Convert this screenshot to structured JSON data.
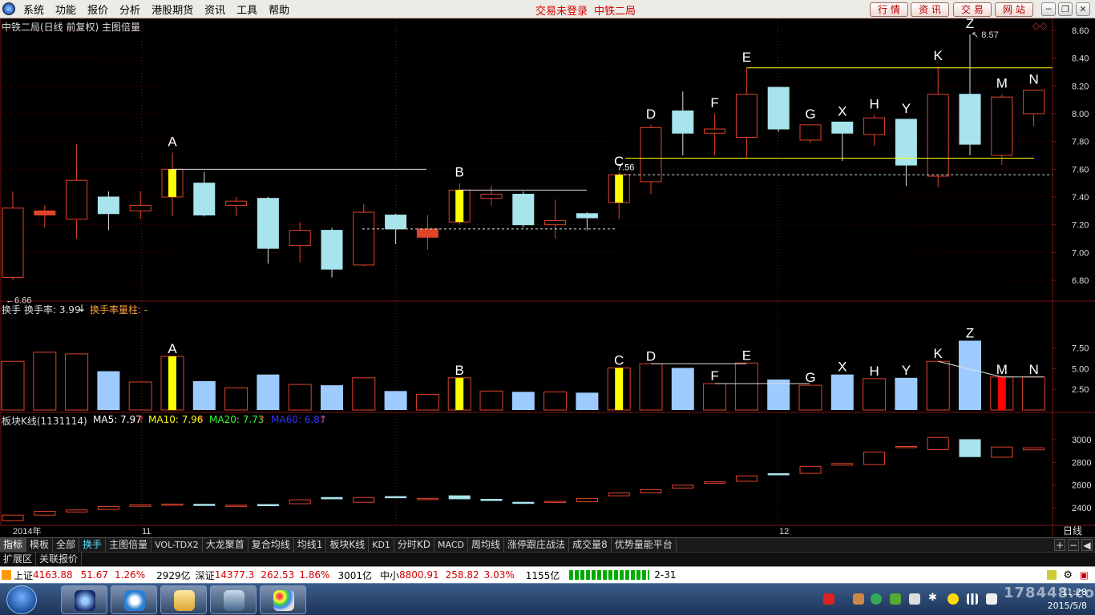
{
  "menubar": {
    "items": [
      "系统",
      "功能",
      "报价",
      "分析",
      "港股期货",
      "资讯",
      "工具",
      "帮助"
    ],
    "trade_status": "交易未登录",
    "stock_name": "中铁二局",
    "buttons": [
      "行 情",
      "资 讯",
      "交 易",
      "网 站"
    ]
  },
  "main_panel": {
    "title": "中铁二局(日线 前复权) 主图倍量",
    "y_ticks": [
      "8.60",
      "8.40",
      "8.20",
      "8.00",
      "7.80",
      "7.60",
      "7.40",
      "7.20",
      "7.00",
      "6.80"
    ],
    "low_label": "6.66",
    "high_label": "8.57",
    "c_label": "7.56"
  },
  "turnover_panel": {
    "label1": "换手",
    "label2": "换手率: 3.99",
    "label3": "换手率量柱: -",
    "y_ticks": [
      "7.50",
      "5.00",
      "2.50"
    ]
  },
  "sector_panel": {
    "label": "板块K线(1131114)",
    "ma5": "MA5: 7.97",
    "ma10": "MA10: 7.96",
    "ma20": "MA20: 7.73",
    "ma60": "MA60: 6.87",
    "y_ticks": [
      "3000",
      "2800",
      "2600",
      "2400"
    ]
  },
  "x_axis": {
    "labels": [
      "2014年",
      "11",
      "12"
    ],
    "period": "日线"
  },
  "chart_data": {
    "type": "candlestick",
    "candles": [
      [
        7.32,
        6.82,
        7.44,
        6.8,
        "up"
      ],
      [
        7.27,
        7.3,
        7.34,
        7.18,
        "dn"
      ],
      [
        7.52,
        7.24,
        7.78,
        7.1,
        "up"
      ],
      [
        7.4,
        7.28,
        7.44,
        7.16,
        "cy"
      ],
      [
        7.34,
        7.3,
        7.44,
        7.24,
        "up"
      ],
      [
        7.6,
        7.4,
        7.72,
        7.26,
        "yl"
      ],
      [
        7.5,
        7.27,
        7.58,
        7.26,
        "cy"
      ],
      [
        7.37,
        7.34,
        7.4,
        7.26,
        "up"
      ],
      [
        7.39,
        7.03,
        7.4,
        6.92,
        "cy"
      ],
      [
        7.16,
        7.05,
        7.22,
        6.93,
        "up"
      ],
      [
        7.16,
        6.88,
        7.18,
        6.82,
        "cy"
      ],
      [
        7.29,
        6.91,
        7.35,
        6.9,
        "up"
      ],
      [
        7.27,
        7.17,
        7.28,
        7.06,
        "cy"
      ],
      [
        7.17,
        7.11,
        7.27,
        7.02,
        "dn"
      ],
      [
        7.45,
        7.22,
        7.5,
        7.2,
        "yl"
      ],
      [
        7.42,
        7.39,
        7.48,
        7.34,
        "up"
      ],
      [
        7.42,
        7.2,
        7.44,
        7.18,
        "cy"
      ],
      [
        7.23,
        7.2,
        7.38,
        7.1,
        "up"
      ],
      [
        7.28,
        7.25,
        7.29,
        7.16,
        "cy"
      ],
      [
        7.56,
        7.36,
        7.58,
        7.24,
        "yl"
      ],
      [
        7.9,
        7.51,
        7.92,
        7.42,
        "up"
      ],
      [
        8.02,
        7.86,
        8.16,
        7.7,
        "cy"
      ],
      [
        7.89,
        7.86,
        8.0,
        7.7,
        "up"
      ],
      [
        8.14,
        7.83,
        8.33,
        7.68,
        "up"
      ],
      [
        8.19,
        7.89,
        8.19,
        7.87,
        "cy"
      ],
      [
        7.92,
        7.81,
        7.92,
        7.79,
        "up"
      ],
      [
        7.94,
        7.86,
        7.94,
        7.66,
        "cy"
      ],
      [
        7.97,
        7.85,
        7.99,
        7.77,
        "up"
      ],
      [
        7.96,
        7.63,
        7.96,
        7.48,
        "cy"
      ],
      [
        8.14,
        7.55,
        8.34,
        7.47,
        "up"
      ],
      [
        8.14,
        7.78,
        8.57,
        7.7,
        "cy"
      ],
      [
        8.12,
        7.7,
        8.14,
        7.63,
        "up"
      ],
      [
        8.17,
        8.0,
        8.17,
        7.91,
        "up"
      ]
    ],
    "letters": [
      "A",
      "B",
      "C",
      "D",
      "E",
      "F",
      "G",
      "X",
      "H",
      "Y",
      "K",
      "Z",
      "M",
      "N"
    ],
    "turnover": [
      [
        5.9,
        "up"
      ],
      [
        7.0,
        "up"
      ],
      [
        6.8,
        "up"
      ],
      [
        4.7,
        "bl"
      ],
      [
        3.4,
        "up"
      ],
      [
        6.5,
        "yl"
      ],
      [
        3.5,
        "bl"
      ],
      [
        2.7,
        "up"
      ],
      [
        4.3,
        "bl"
      ],
      [
        3.1,
        "up"
      ],
      [
        3.0,
        "bl"
      ],
      [
        3.9,
        "up"
      ],
      [
        2.3,
        "bl"
      ],
      [
        1.9,
        "up"
      ],
      [
        3.9,
        "yl"
      ],
      [
        2.3,
        "up"
      ],
      [
        2.2,
        "bl"
      ],
      [
        2.2,
        "up"
      ],
      [
        2.1,
        "bl"
      ],
      [
        5.1,
        "yl"
      ],
      [
        5.6,
        "up"
      ],
      [
        5.1,
        "bl"
      ],
      [
        3.2,
        "up"
      ],
      [
        5.7,
        "up"
      ],
      [
        3.7,
        "bl"
      ],
      [
        3.0,
        "up"
      ],
      [
        4.3,
        "bl"
      ],
      [
        3.8,
        "up"
      ],
      [
        3.9,
        "bl"
      ],
      [
        5.9,
        "up"
      ],
      [
        8.4,
        "bl"
      ],
      [
        4.0,
        "rd"
      ],
      [
        4.0,
        "up"
      ]
    ],
    "sector": [
      [
        2335,
        2285,
        "up"
      ],
      [
        2368,
        2335,
        "up"
      ],
      [
        2380,
        2362,
        "up"
      ],
      [
        2410,
        2385,
        "up"
      ],
      [
        2425,
        2413,
        "up"
      ],
      [
        2432,
        2422,
        "up"
      ],
      [
        2430,
        2420,
        "cy"
      ],
      [
        2422,
        2412,
        "up"
      ],
      [
        2428,
        2420,
        "cy"
      ],
      [
        2470,
        2435,
        "up"
      ],
      [
        2490,
        2478,
        "cy"
      ],
      [
        2490,
        2448,
        "up"
      ],
      [
        2498,
        2488,
        "cy"
      ],
      [
        2482,
        2475,
        "up"
      ],
      [
        2505,
        2478,
        "cy"
      ],
      [
        2474,
        2466,
        "cy"
      ],
      [
        2448,
        2440,
        "cy"
      ],
      [
        2456,
        2447,
        "up"
      ],
      [
        2482,
        2452,
        "up"
      ],
      [
        2530,
        2505,
        "up"
      ],
      [
        2560,
        2530,
        "up"
      ],
      [
        2598,
        2573,
        "up"
      ],
      [
        2628,
        2615,
        "up"
      ],
      [
        2680,
        2633,
        "up"
      ],
      [
        2700,
        2690,
        "cy"
      ],
      [
        2765,
        2703,
        "up"
      ],
      [
        2790,
        2775,
        "up"
      ],
      [
        2890,
        2780,
        "up"
      ],
      [
        2940,
        2930,
        "up"
      ],
      [
        3020,
        2912,
        "up"
      ],
      [
        3000,
        2850,
        "cy"
      ],
      [
        2935,
        2845,
        "up"
      ],
      [
        2928,
        2910,
        "up"
      ]
    ]
  },
  "tabs": [
    "指标",
    "模板",
    "全部",
    "换手",
    "主图倍量",
    "VOL-TDX2",
    "大龙聚首",
    "复合均线",
    "均线1",
    "板块K线",
    "KD1",
    "分时KD",
    "MACD",
    "周均线",
    "涨停跟庄战法",
    "成交量8",
    "优势量能平台"
  ],
  "tabs2": [
    "扩展区",
    "关联报价"
  ],
  "tab_ctl": [
    "+",
    "−",
    "◀"
  ],
  "ticker": {
    "sh_name": "上证",
    "sh_val": "4163.88",
    "sh_chg": "51.67",
    "sh_pct": "1.26%",
    "sh_amt": "2929亿",
    "sz_name": "深证",
    "sz_val": "14377.3",
    "sz_chg": "262.53",
    "sz_pct": "1.86%",
    "sz_amt": "3001亿",
    "zx_name": "中小",
    "zx_val": "8800.91",
    "zx_chg": "258.82",
    "zx_pct": "3.03%",
    "zx_amt": "1155亿",
    "misc": "2-31"
  },
  "clock": {
    "time": "11:28",
    "date": "2015/5/8"
  },
  "watermark": "178448.com",
  "colors": {
    "up": "#e0442a",
    "cyan": "#a8e4ec",
    "yellow": "#ffff00",
    "red": "#ff0000",
    "blue": "#9ecbff",
    "grid": "#7a1414"
  }
}
